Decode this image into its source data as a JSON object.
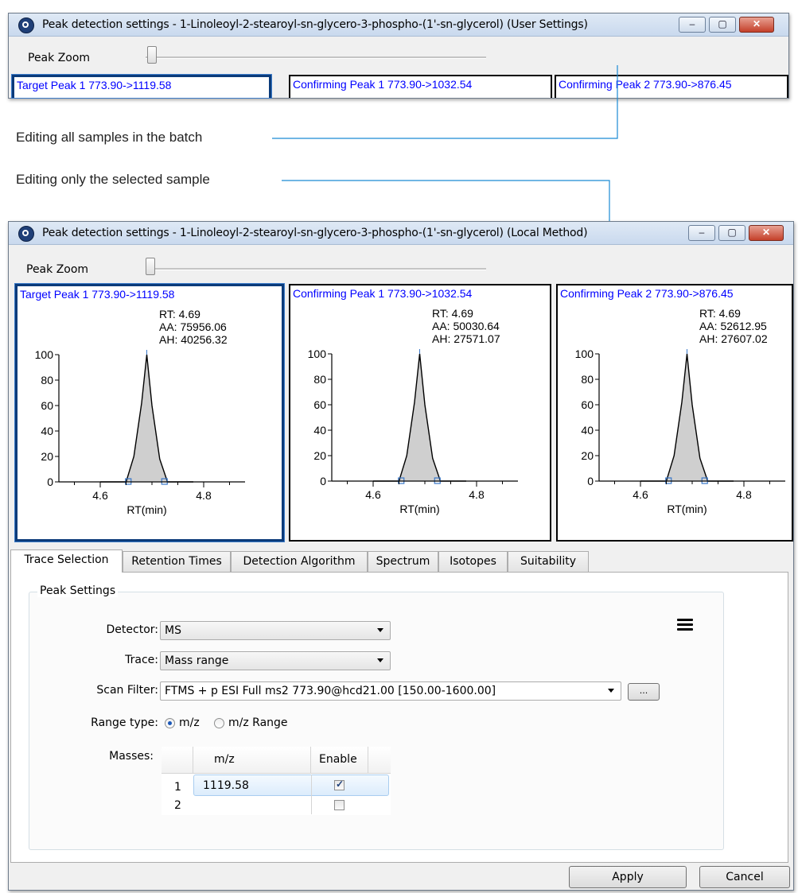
{
  "top_window": {
    "title": "Peak detection settings - 1-Linoleoyl-2-stearoyl-sn-glycero-3-phospho-(1'-sn-glycerol) (User Settings)",
    "zoom_label": "Peak Zoom",
    "peaks": [
      {
        "title": "Target Peak 1   773.90->1119.58"
      },
      {
        "title": "Confirming Peak 1   773.90->1032.54"
      },
      {
        "title": "Confirming Peak 2   773.90->876.45"
      }
    ]
  },
  "callouts": {
    "all_samples": "Editing all samples in the batch",
    "selected_sample": "Editing only the selected sample"
  },
  "window": {
    "title": "Peak detection settings - 1-Linoleoyl-2-stearoyl-sn-glycero-3-phospho-(1'-sn-glycerol) (Local Method)",
    "zoom_label": "Peak Zoom",
    "minimize": "‒",
    "maximize": "▢",
    "close": "✕"
  },
  "peaks": [
    {
      "title": "Target Peak 1   773.90->1119.58",
      "rt": "RT: 4.69",
      "aa": "AA: 75956.06",
      "ah": "AH: 40256.32"
    },
    {
      "title": "Confirming Peak 1   773.90->1032.54",
      "rt": "RT: 4.69",
      "aa": "AA: 50030.64",
      "ah": "AH: 27571.07"
    },
    {
      "title": "Confirming Peak 2   773.90->876.45",
      "rt": "RT: 4.69",
      "aa": "AA: 52612.95",
      "ah": "AH: 27607.02"
    }
  ],
  "chart_data": {
    "type": "line",
    "xlabel": "RT(min)",
    "x_ticks": [
      "4.6",
      "4.8"
    ],
    "y_ticks": [
      "0",
      "20",
      "40",
      "60",
      "80",
      "100"
    ],
    "ylim": [
      0,
      100
    ],
    "peak_apex_rt": 4.69,
    "series": [
      {
        "x": [
          4.6,
          4.65,
          4.665,
          4.68,
          4.69,
          4.7,
          4.715,
          4.73,
          4.78
        ],
        "values": [
          0,
          0,
          20,
          62,
          100,
          60,
          18,
          0,
          0
        ]
      }
    ]
  },
  "tabs": [
    "Trace Selection",
    "Retention Times",
    "Detection Algorithm",
    "Spectrum",
    "Isotopes",
    "Suitability"
  ],
  "peak_settings": {
    "group_label": "Peak Settings",
    "detector_label": "Detector:",
    "detector_value": "MS",
    "trace_label": "Trace:",
    "trace_value": "Mass range",
    "scan_filter_label": "Scan Filter:",
    "scan_filter_value": "FTMS + p ESI Full ms2 773.90@hcd21.00 [150.00-1600.00]",
    "browse_label": "...",
    "range_type_label": "Range type:",
    "range_options": [
      "m/z",
      "m/z Range"
    ],
    "masses_label": "Masses:",
    "grid_headers": [
      "m/z",
      "Enable"
    ],
    "grid_rows": [
      {
        "index": "1",
        "mz": "1119.58",
        "enabled": true
      },
      {
        "index": "2",
        "mz": "",
        "enabled": false
      }
    ]
  },
  "buttons": {
    "apply": "Apply",
    "cancel": "Cancel"
  }
}
